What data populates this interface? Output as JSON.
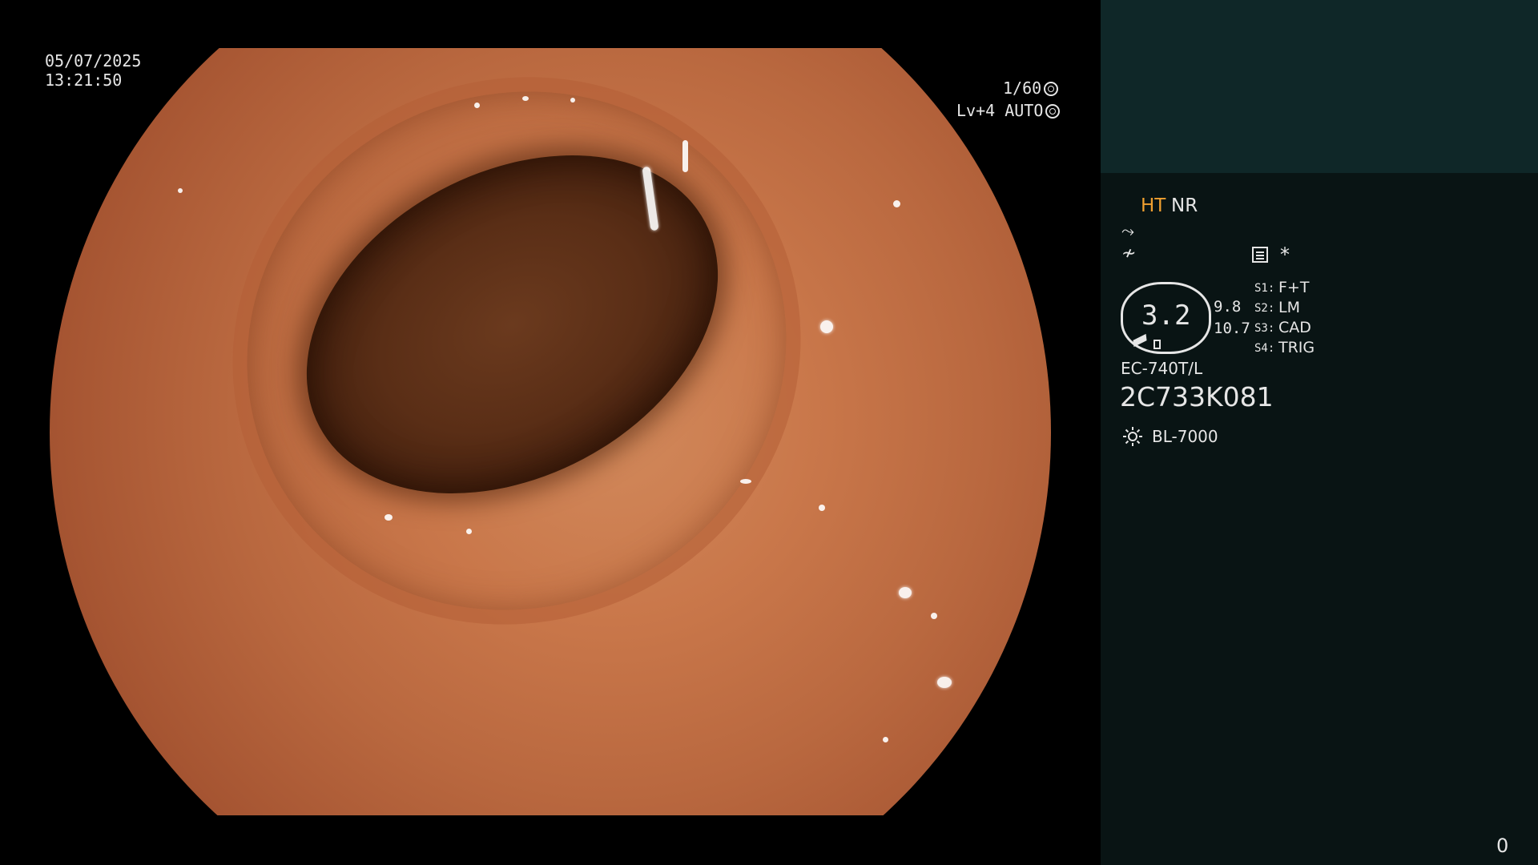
{
  "overlay": {
    "date": "05/07/2025",
    "time": "13:21:50",
    "shutter": "1/60",
    "level": "Lv+4 AUTO"
  },
  "panel": {
    "ht_label": "HT",
    "nr_label": "NR",
    "symbol_1": "⤳",
    "symbol_2": "≁",
    "asterisk": "*",
    "iris_value": "3.2",
    "value_1": "9.8",
    "value_2": "10.7",
    "switches": [
      {
        "key": "S1:",
        "value": "F+T"
      },
      {
        "key": "S2:",
        "value": "LM"
      },
      {
        "key": "S3:",
        "value": "CAD"
      },
      {
        "key": "S4:",
        "value": "TRIG"
      }
    ],
    "scope_model": "EC-740T/L",
    "scope_serial": "2C733K081",
    "light_source": "BL-7000",
    "counter": "0"
  },
  "colors": {
    "panel_top": "#0f2728",
    "panel_bg": "#091414",
    "ht_accent": "#f0a030",
    "text": "#e6e6e6"
  },
  "icons": [
    "shutter-icon",
    "auto-iris-icon",
    "enhancement-icon",
    "structure-icon",
    "menu-icon",
    "lamp-icon"
  ]
}
